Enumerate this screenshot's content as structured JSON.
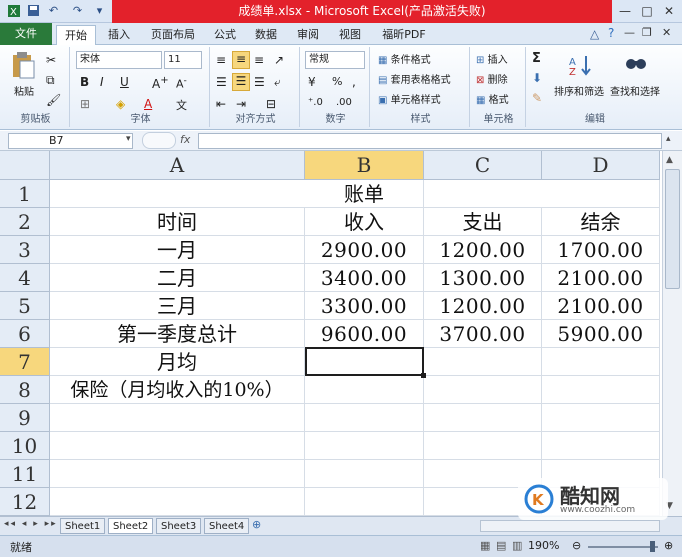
{
  "window": {
    "title": "成绩单.xlsx - Microsoft Excel(产品激活失败)",
    "min": "—",
    "max": "□",
    "close": "✕"
  },
  "quick_access": [
    "save-icon",
    "undo-icon",
    "redo-icon"
  ],
  "tabs": [
    "开始",
    "插入",
    "页面布局",
    "公式",
    "数据",
    "审阅",
    "视图",
    "福昕PDF"
  ],
  "file_tab": "文件",
  "ribbon": {
    "clipboard": {
      "paste": "粘贴",
      "label": "剪贴板"
    },
    "font": {
      "name": "宋体",
      "size": "11",
      "label": "字体",
      "bold": "B",
      "italic": "I",
      "underline": "U"
    },
    "align": {
      "label": "对齐方式"
    },
    "number": {
      "format": "常规",
      "label": "数字",
      "pct": "%",
      "comma": ","
    },
    "styles": {
      "cond": "条件格式",
      "table": "套用表格格式",
      "cell": "单元格样式",
      "label": "样式"
    },
    "cells": {
      "insert": "插入",
      "delete": "删除",
      "format": "格式",
      "label": "单元格"
    },
    "editing": {
      "sum": "Σ",
      "sort": "排序和筛选",
      "find": "查找和选择",
      "label": "编辑"
    }
  },
  "formula_bar": {
    "name_box": "B7",
    "fx": "fx",
    "value": ""
  },
  "sheet": {
    "columns": [
      "A",
      "B",
      "C",
      "D"
    ],
    "rows": [
      "1",
      "2",
      "3",
      "4",
      "5",
      "6",
      "7",
      "8",
      "9",
      "10",
      "11",
      "12"
    ],
    "cells": {
      "r1": {
        "a": "",
        "b": "账单",
        "c": "",
        "d": ""
      },
      "r2": {
        "a": "时间",
        "b": "收入",
        "c": "支出",
        "d": "结余"
      },
      "r3": {
        "a": "一月",
        "b": "2900.00",
        "c": "1200.00",
        "d": "1700.00"
      },
      "r4": {
        "a": "二月",
        "b": "3400.00",
        "c": "1300.00",
        "d": "2100.00"
      },
      "r5": {
        "a": "三月",
        "b": "3300.00",
        "c": "1200.00",
        "d": "2100.00"
      },
      "r6": {
        "a": "第一季度总计",
        "b": "9600.00",
        "c": "3700.00",
        "d": "5900.00"
      },
      "r7": {
        "a": "月均",
        "b": "",
        "c": "",
        "d": ""
      },
      "r8": {
        "a": "保险（月均收入的10%）",
        "b": "",
        "c": "",
        "d": ""
      }
    }
  },
  "sheet_tabs": [
    "Sheet1",
    "Sheet2",
    "Sheet3",
    "Sheet4"
  ],
  "status": {
    "ready": "就绪",
    "zoom": "190%"
  },
  "watermark": {
    "brand": "酷知网",
    "url": "www.coozhi.com"
  }
}
